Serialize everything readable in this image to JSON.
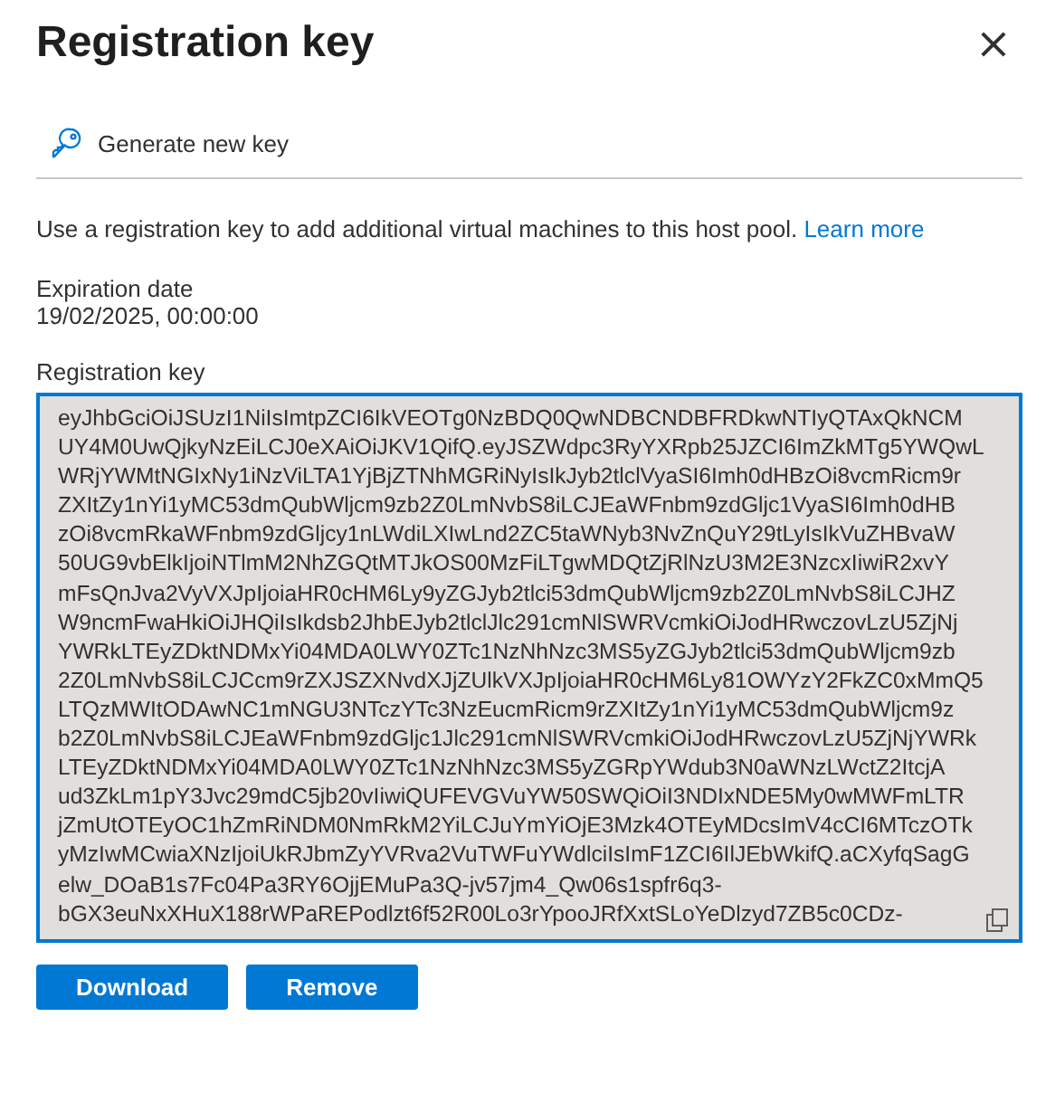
{
  "panel": {
    "title": "Registration key",
    "close": "×"
  },
  "toolbar": [
    {
      "label": "Generate new key",
      "kind": "key"
    }
  ],
  "description": {
    "text": "Use a registration key to add additional virtual machines to this host pool.",
    "link": "Learn more"
  },
  "expiration": {
    "label": "Expiration date",
    "value": "19/02/2025, 00:00:00"
  },
  "key_field": {
    "label": "Registration key",
    "readonly": true,
    "value_lines": [
      "eyJhbGciOiJSUzI1NiIsImtpZCI6IkVEOTg0NzBDQ0QwNDBCNDBFRDkwNTIyQTAxQkNCM",
      "UY4M0UwQjkyNzEiLCJ0eXAiOiJKV1QifQ.eyJSZWdpc3RyYXRpb25JZCI6ImZkMTg5YWQwL",
      "WRjYWMtNGIxNy1iNzViLTA1YjBjZTNhMGRiNyIsIkJyb2tlclVyaSI6Imh0dHBzOi8vcmRicm9r",
      "ZXItZy1nYi1yMC53dmQubWljcm9zb2Z0LmNvbS8iLCJEaWFnbm9zdGljc1VyaSI6Imh0dHB",
      "zOi8vcmRkaWFnbm9zdGljcy1nLWdiLXIwLnd2ZC5taWNyb3NvZnQuY29tLyIsIkVuZHBvaW",
      "50UG9vbElkIjoiNTlmM2NhZGQtMTJkOS00MzFiLTgwMDQtZjRlNzU3M2E3NzcxIiwiR2xvY",
      "mFsQnJva2VyVXJpIjoiaHR0cHM6Ly9yZGJyb2tlci53dmQubWljcm9zb2Z0LmNvbS8iLCJHZ",
      "W9ncmFwaHkiOiJHQiIsIkdsb2JhbEJyb2tlclJlc291cmNlSWRVcmkiOiJodHRwczovLzU5ZjNj",
      "YWRkLTEyZDktNDMxYi04MDA0LWY0ZTc1NzNhNzc3MS5yZGJyb2tlci53dmQubWljcm9zb",
      "2Z0LmNvbS8iLCJCcm9rZXJSZXNvdXJjZUlkVXJpIjoiaHR0cHM6Ly81OWYzY2FkZC0xMmQ5",
      "LTQzMWItODAwNC1mNGU3NTczYTc3NzEucmRicm9rZXItZy1nYi1yMC53dmQubWljcm9z",
      "b2Z0LmNvbS8iLCJEaWFnbm9zdGljc1Jlc291cmNlSWRVcmkiOiJodHRwczovLzU5ZjNjYWRk",
      "LTEyZDktNDMxYi04MDA0LWY0ZTc1NzNhNzc3MS5yZGRpYWdub3N0aWNzLWctZ2ItcjA",
      "ud3ZkLm1pY3Jvc29mdC5jb20vIiwiQUFEVGVuYW50SWQiOiI3NDIxNDE5My0wMWFmLTR",
      "jZmUtOTEyOC1hZmRiNDM0NmRkM2YiLCJuYmYiOjE3Mzk4OTEyMDcsImV4cCI6MTczOTk",
      "yMzIwMCwiaXNzIjoiUkRJbmZyYVRva2VuTWFuYWdlciIsImF1ZCI6IlJEbWkifQ.aCXyfqSagG",
      "elw_DOaB1s7Fc04Pa3RY6OjjEMuPa3Q-jv57jm4_Qw06s1spfr6q3-",
      "bGX3euNxXHuX188rWPaREPodlzt6f52R00Lo3rYpooJRfXxtSLoYeDlzyd7ZB5c0CDz-"
    ]
  },
  "buttons": [
    "Download",
    "Remove"
  ]
}
